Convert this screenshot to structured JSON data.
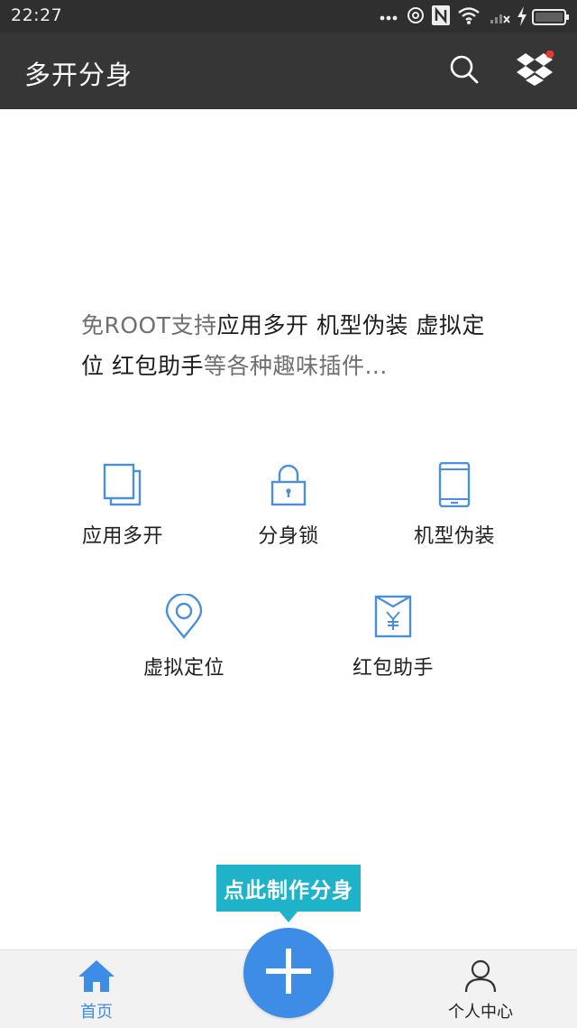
{
  "status_bar": {
    "time": "22:27",
    "icons": [
      "more-dots-icon",
      "hotspot-icon",
      "nfc-icon",
      "wifi-icon",
      "signal-icon",
      "charging-icon",
      "battery-icon"
    ]
  },
  "app_bar": {
    "title": "多开分身",
    "actions": [
      "search-icon",
      "dropbox-icon"
    ],
    "notification_dot_color": "#e53935"
  },
  "intro": {
    "part1_muted": "免ROOT支持",
    "part2_strong": "应用多开 机型伪装 虚拟定位 红包助手",
    "part3_muted": "等各种趣味插件..."
  },
  "features": [
    {
      "label": "应用多开",
      "icon": "multi-window-icon"
    },
    {
      "label": "分身锁",
      "icon": "lock-icon"
    },
    {
      "label": "机型伪装",
      "icon": "phone-icon"
    },
    {
      "label": "虚拟定位",
      "icon": "location-pin-icon"
    },
    {
      "label": "红包助手",
      "icon": "red-envelope-icon"
    }
  ],
  "tooltip": {
    "text": "点此制作分身"
  },
  "bottom_nav": {
    "home_label": "首页",
    "profile_label": "个人中心",
    "fab_icon": "plus-icon"
  },
  "colors": {
    "accent_blue": "#3d8de6",
    "tooltip_teal": "#1fb3c9",
    "app_bar": "#363636",
    "icon_blue": "#4a8fdc"
  }
}
